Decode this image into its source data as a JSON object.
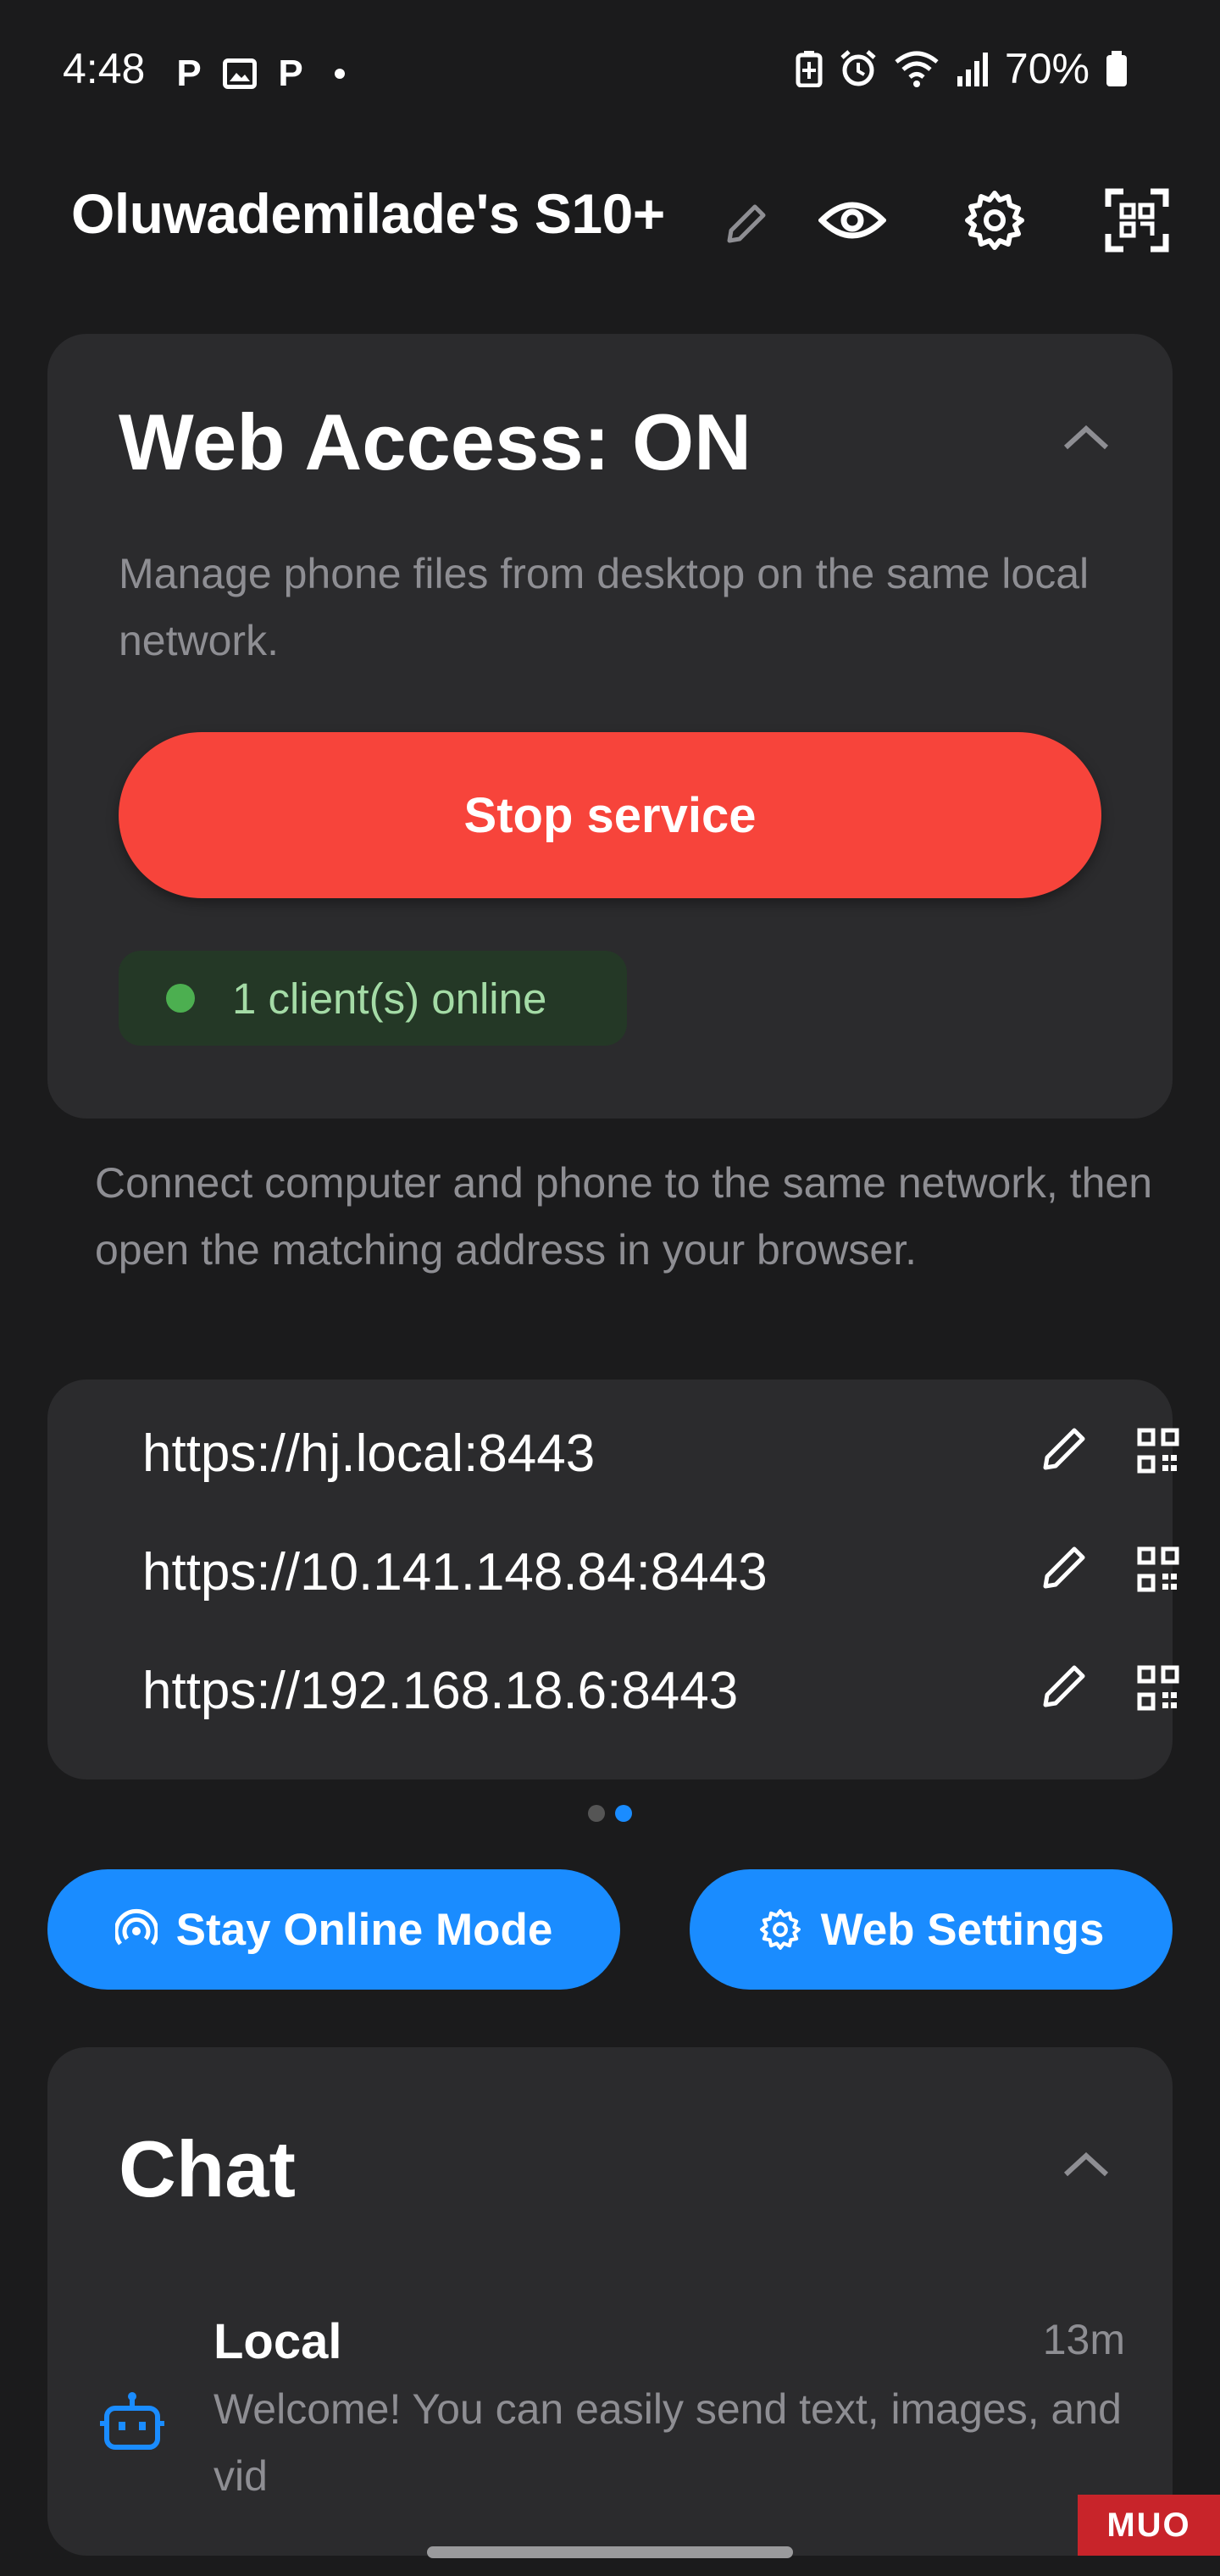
{
  "status_bar": {
    "time": "4:48",
    "left_icons": [
      "p-icon",
      "gallery-icon",
      "p-icon",
      "dot"
    ],
    "battery_percent": "70%",
    "right_icons": [
      "battery-saver-icon",
      "alarm-icon",
      "wifi-icon",
      "signal-icon",
      "battery-icon"
    ]
  },
  "header": {
    "device_name": "Oluwademilade's S10+",
    "actions": [
      "edit-icon",
      "eye-icon",
      "gear-icon",
      "scan-icon"
    ]
  },
  "web_access": {
    "title": "Web Access: ON",
    "description": "Manage phone files from desktop on the same local network.",
    "stop_button": "Stop service",
    "clients_status": "1 client(s) online",
    "status_color": "#4caf50"
  },
  "instructions": "Connect computer and phone to the same network, then open the matching address in your browser.",
  "addresses": [
    {
      "url": "https://hj.local:8443"
    },
    {
      "url": "https://10.141.148.84:8443"
    },
    {
      "url": "https://192.168.18.6:8443"
    }
  ],
  "pager": {
    "count": 2,
    "active_index": 1
  },
  "buttons": {
    "stay_online": "Stay Online Mode",
    "web_settings": "Web Settings"
  },
  "chat": {
    "title": "Chat",
    "items": [
      {
        "name": "Local",
        "time": "13m",
        "preview": "Welcome! You can easily send text, images, and vid"
      }
    ]
  },
  "watermark": "MUO",
  "colors": {
    "accent_blue": "#1a8cff",
    "danger_red": "#f7443b",
    "card_bg": "#2b2b2d",
    "page_bg": "#1b1b1c"
  }
}
